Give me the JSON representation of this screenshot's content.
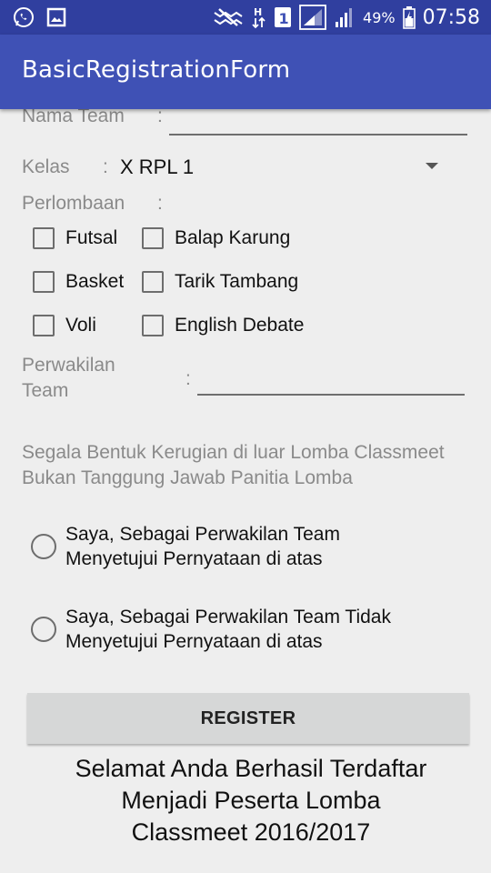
{
  "status_bar": {
    "left_icons": [
      "whatsapp-icon",
      "image-icon"
    ],
    "right_icons": [
      "mute-icon",
      "data-arrows-icon",
      "sim1-icon",
      "signal-icon",
      "signal2-icon",
      "battery-icon"
    ],
    "battery_percent": "49%",
    "time": "07:58"
  },
  "app_bar": {
    "title": "BasicRegistrationForm"
  },
  "form": {
    "nama_team_label": "Nama Team",
    "nama_team_colon": ":",
    "nama_team_value": "",
    "kelas_label": "Kelas",
    "kelas_colon": ":",
    "kelas_selected": "X RPL 1",
    "perlombaan_label": "Perlombaan",
    "perlombaan_colon": ":",
    "checkboxes": {
      "futsal": "Futsal",
      "balap_karung": "Balap Karung",
      "basket": "Basket",
      "tarik_tambang": "Tarik Tambang",
      "voli": "Voli",
      "english_debate": "English Debate"
    },
    "perwakilan_label_line1": "Perwakilan",
    "perwakilan_label_line2": "Team",
    "perwakilan_colon": ":",
    "disclaimer_line1": "Segala Bentuk Kerugian di luar Lomba Classmeet",
    "disclaimer_line2": "Bukan Tanggung Jawab Panitia Lomba",
    "radio_agree_line1": "Saya, Sebagai Perwakilan Team",
    "radio_agree_line2": "Menyetujui Pernyataan di atas",
    "radio_disagree_line1": "Saya, Sebagai Perwakilan Team Tidak",
    "radio_disagree_line2": "Menyetujui Pernyataan di atas",
    "register_button": "REGISTER",
    "result_line1": "Selamat Anda Berhasil Terdaftar",
    "result_line2": "Menjadi Peserta Lomba",
    "result_line3": "Classmeet 2016/2017"
  }
}
